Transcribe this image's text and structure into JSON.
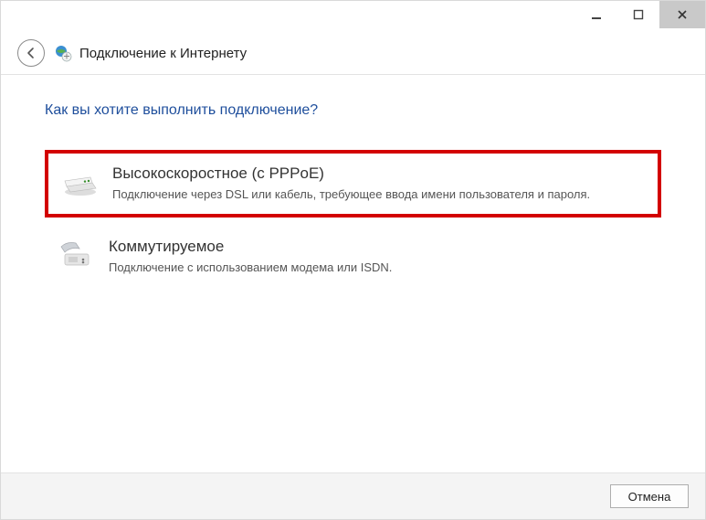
{
  "window": {
    "title": "Подключение к Интернету"
  },
  "question": "Как вы хотите выполнить подключение?",
  "options": [
    {
      "title": "Высокоскоростное (с PPPoE)",
      "desc": "Подключение через DSL или кабель, требующее ввода имени пользователя и пароля."
    },
    {
      "title": "Коммутируемое",
      "desc": "Подключение с использованием модема или ISDN."
    }
  ],
  "buttons": {
    "cancel": "Отмена"
  }
}
